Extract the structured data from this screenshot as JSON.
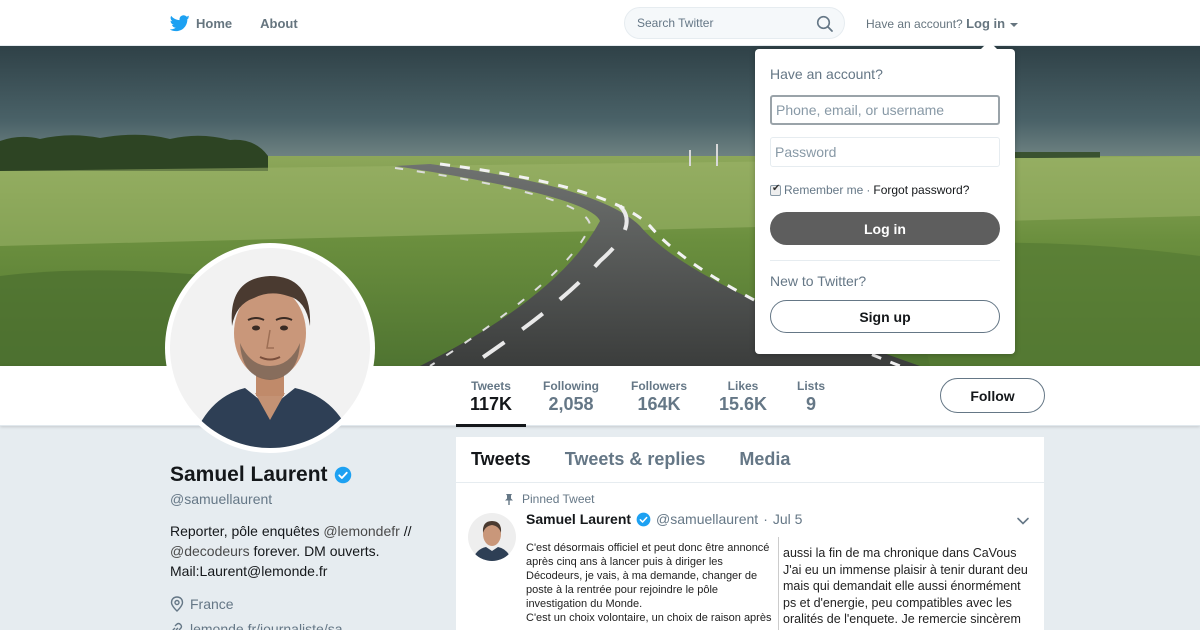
{
  "nav": {
    "home_label": "Home",
    "about_label": "About",
    "search_placeholder": "Search Twitter",
    "account_prompt": "Have an account?",
    "login_label": "Log in"
  },
  "login_dropdown": {
    "title": "Have an account?",
    "username_placeholder": "Phone, email, or username",
    "password_placeholder": "Password",
    "remember_label": "Remember me",
    "separator": "·",
    "forgot_label": "Forgot password?",
    "login_button": "Log in",
    "new_prompt": "New to Twitter?",
    "signup_button": "Sign up"
  },
  "profile_nav": {
    "stats": [
      {
        "label": "Tweets",
        "value": "117K"
      },
      {
        "label": "Following",
        "value": "2,058"
      },
      {
        "label": "Followers",
        "value": "164K"
      },
      {
        "label": "Likes",
        "value": "15.6K"
      },
      {
        "label": "Lists",
        "value": "9"
      }
    ],
    "follow_button": "Follow"
  },
  "profile": {
    "name": "Samuel Laurent",
    "handle": "@samuellaurent",
    "bio_1": "Reporter, pôle enquêtes ",
    "bio_mention_1": "@lemondefr",
    "bio_2": " //",
    "bio_mention_2": "@decodeurs",
    "bio_3": " forever. DM ouverts.",
    "bio_4": "Mail:Laurent@lemonde.fr",
    "location": "France",
    "website": "lemonde.fr/journaliste/sa..."
  },
  "timeline": {
    "tabs": [
      "Tweets",
      "Tweets & replies",
      "Media"
    ],
    "pinned_label": "Pinned Tweet",
    "tweet": {
      "name": "Samuel Laurent",
      "handle": "@samuellaurent",
      "separator": "·",
      "date": "Jul 5",
      "image_left": [
        "C'est désormais officiel et peut donc être annoncé",
        "après cinq ans à lancer puis à diriger les",
        "Décodeurs, je vais, à ma demande, changer de",
        "poste à la rentrée pour rejoindre le pôle",
        "investigation du Monde.",
        "C'est un choix volontaire, un choix de raison après"
      ],
      "image_right": [
        "aussi la fin de ma chronique dans CaVous",
        "J'ai eu un immense plaisir à tenir durant deu",
        "mais qui demandait elle aussi énormément",
        "ps et d'energie, peu compatibles avec les",
        "oralités de l'enquete. Je remercie sincèrem"
      ]
    }
  },
  "colors": {
    "accent": "#1da1f2",
    "verified": "#1da1f2",
    "login_button_bg": "#5e5e5e"
  }
}
